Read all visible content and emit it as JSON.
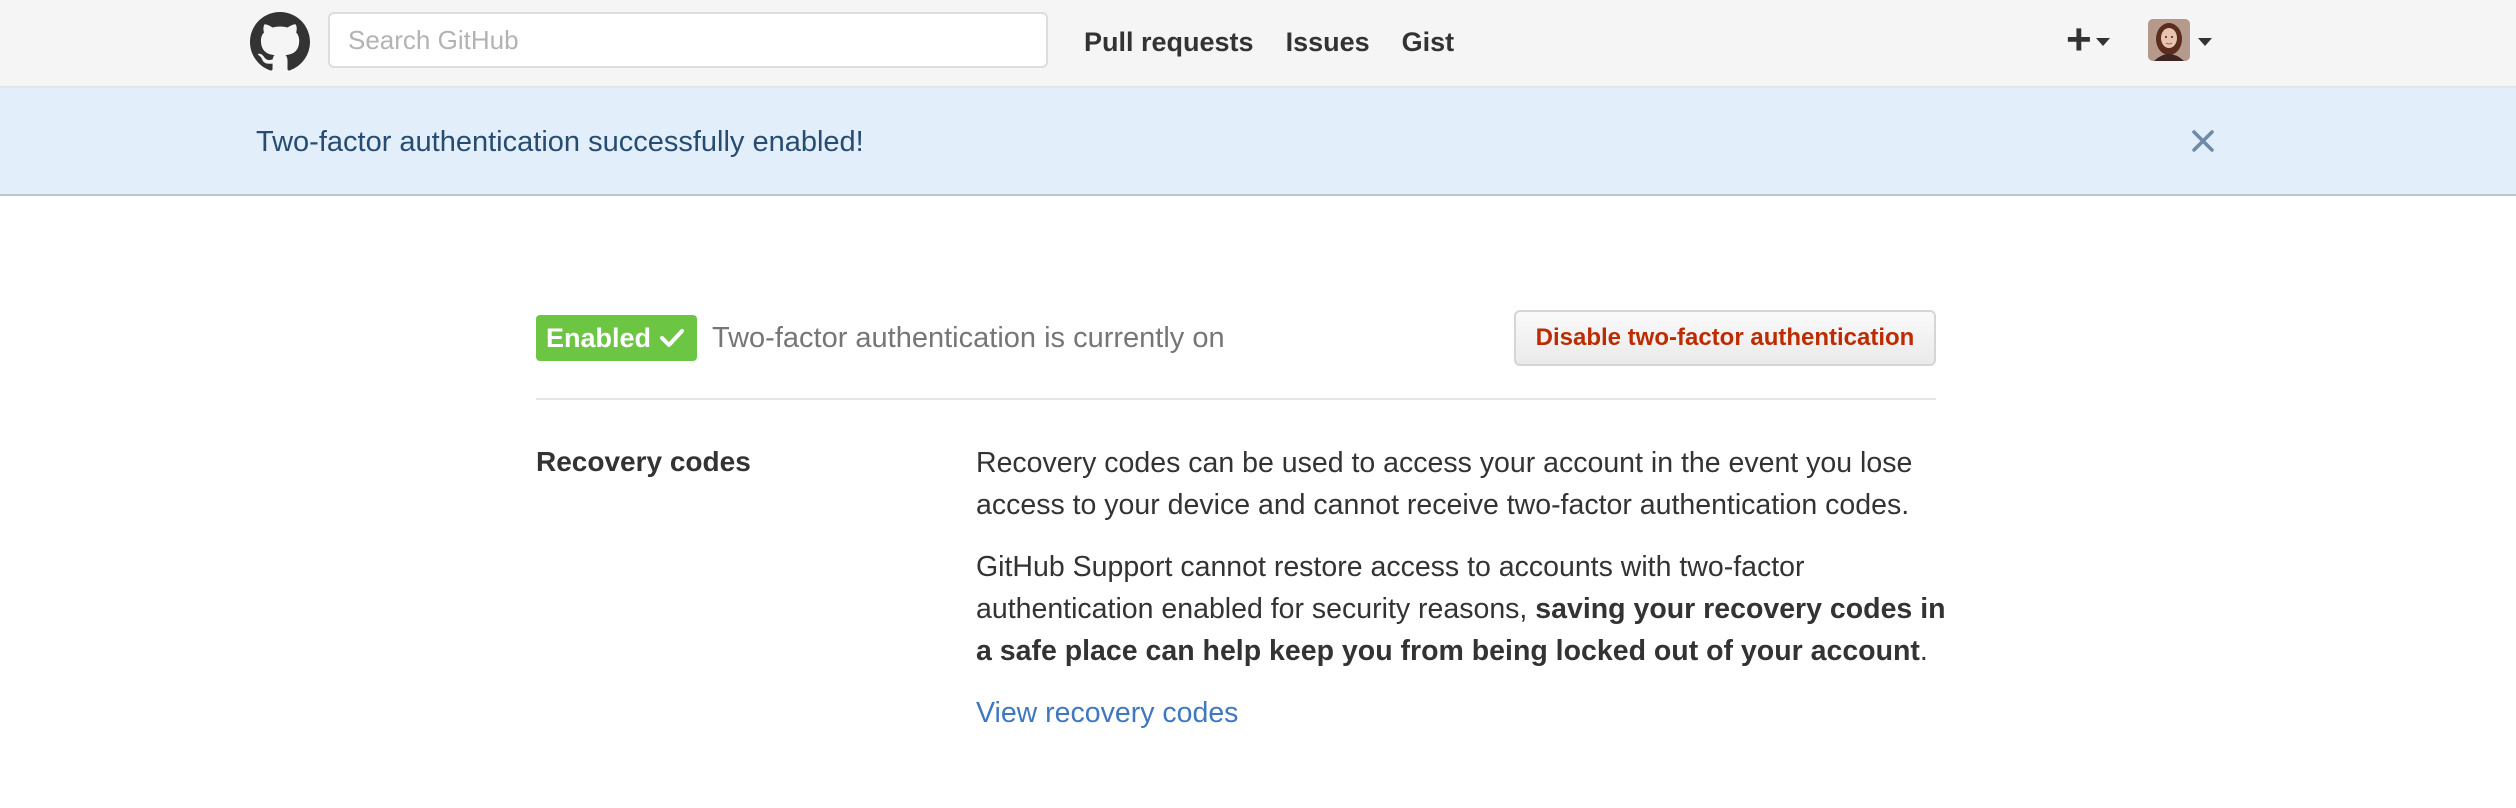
{
  "header": {
    "search_placeholder": "Search GitHub",
    "nav": [
      {
        "label": "Pull requests"
      },
      {
        "label": "Issues"
      },
      {
        "label": "Gist"
      }
    ],
    "plus_symbol": "+"
  },
  "flash": {
    "message": "Two-factor authentication successfully enabled!"
  },
  "two_factor": {
    "badge_label": "Enabled",
    "status_text": "Two-factor authentication is currently on",
    "disable_button": "Disable two-factor authentication"
  },
  "recovery": {
    "label": "Recovery codes",
    "paragraph_1": "Recovery codes can be used to access your account in the event you lose access to your device and cannot receive two-factor authentication codes.",
    "paragraph_2_plain": "GitHub Support cannot restore access to accounts with two-factor authentication enabled for security reasons, ",
    "paragraph_2_bold": "saving your recovery codes in a safe place can help keep you from being locked out of your account",
    "paragraph_2_end": ".",
    "view_link": "View recovery codes"
  },
  "colors": {
    "header_bg": "#f5f5f5",
    "flash_bg": "#e2eef9",
    "flash_text": "#264c72",
    "badge_green": "#6cc644",
    "danger_text": "#bd2c00",
    "link_blue": "#4078c0"
  },
  "icons": {
    "logo": "github-octocat-icon",
    "close": "close-icon",
    "check": "check-icon",
    "caret": "caret-down-icon"
  }
}
